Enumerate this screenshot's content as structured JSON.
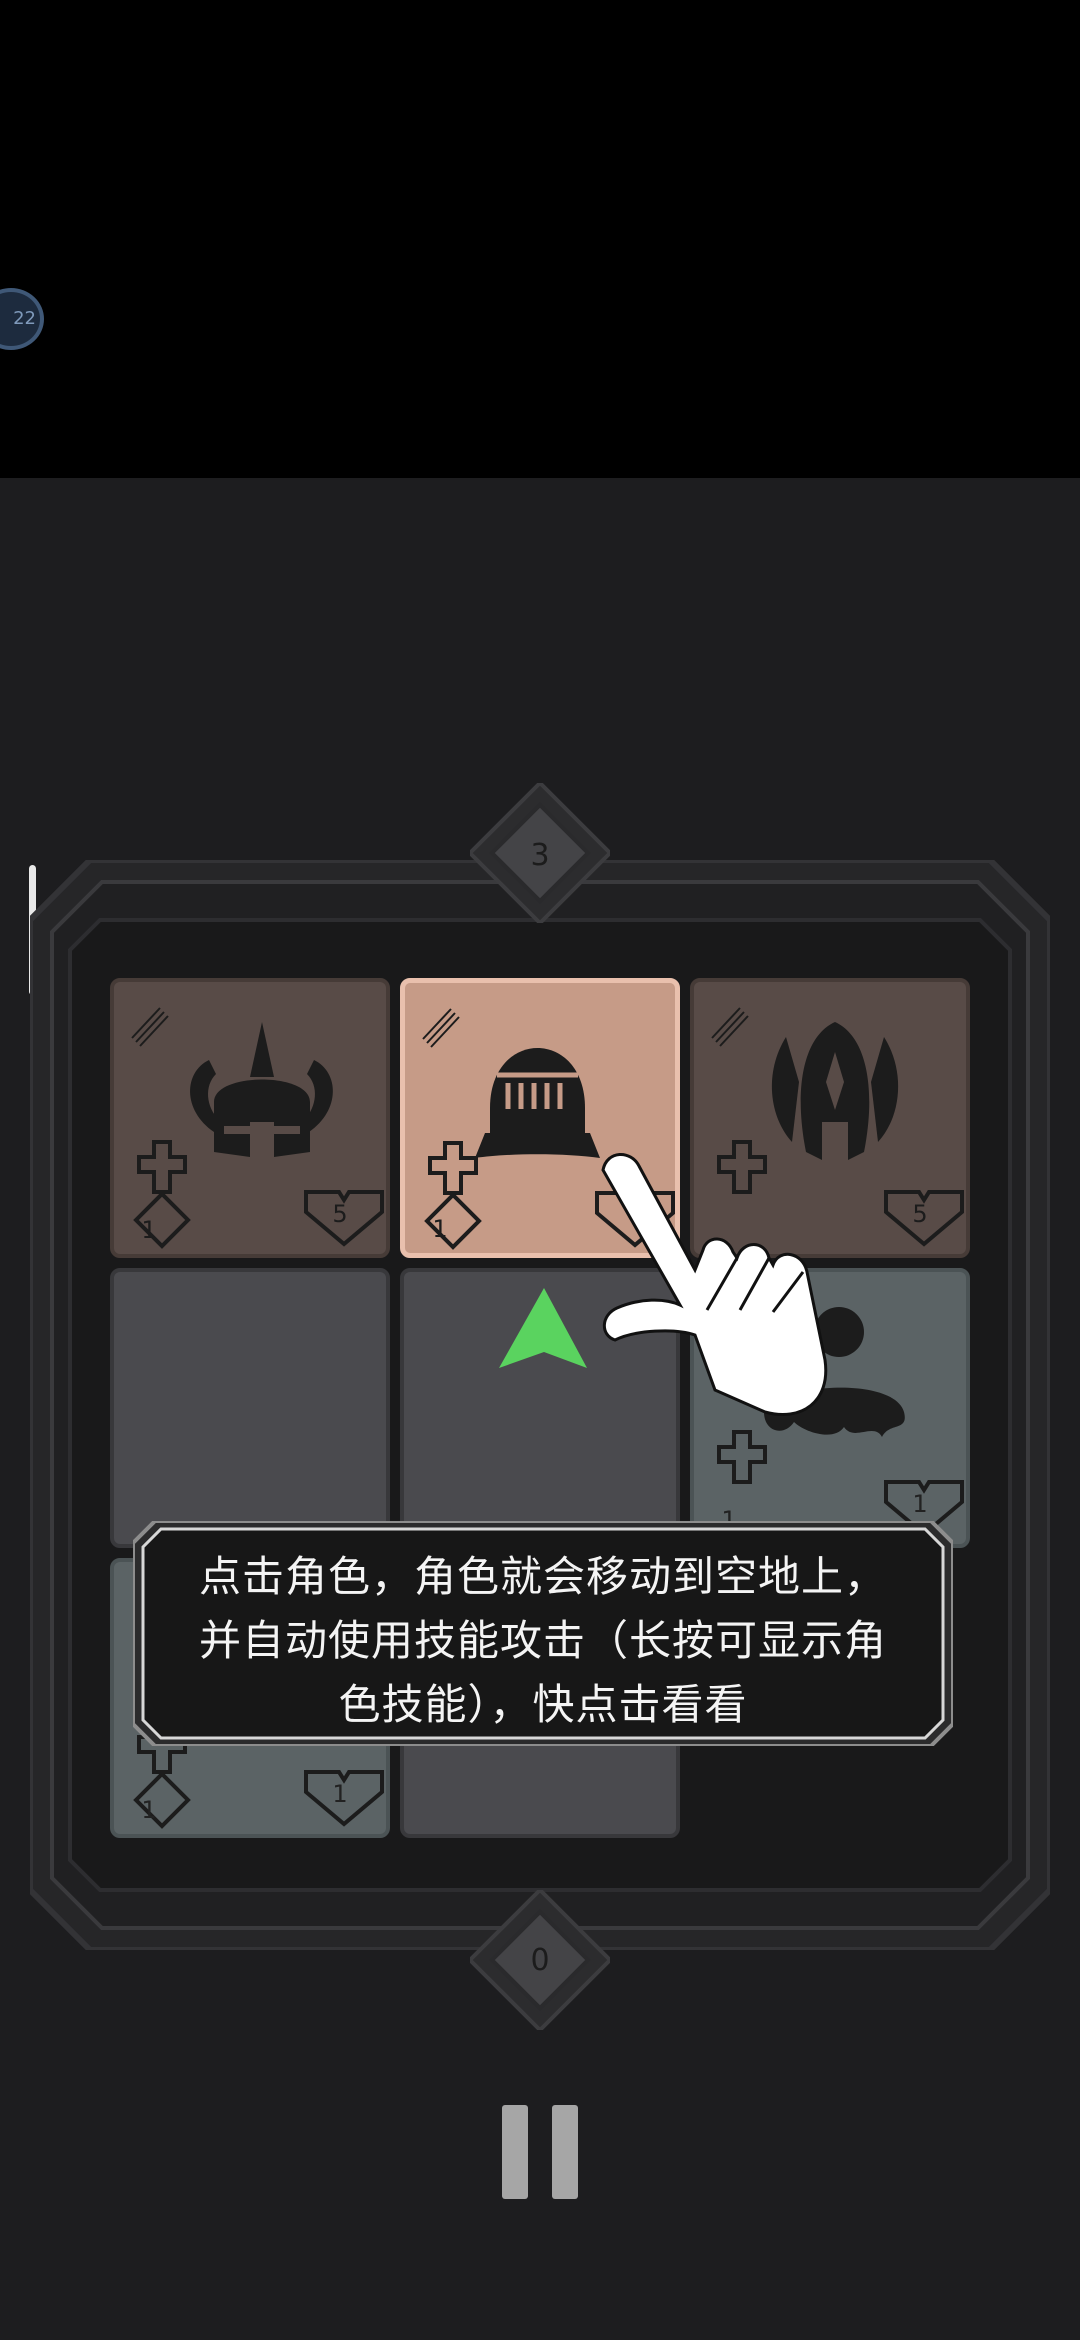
{
  "status_badge": {
    "text": "22"
  },
  "board": {
    "top_counter": "3",
    "bottom_counter": "0",
    "tiles": [
      {
        "kind": "hero",
        "icon": "horned-helmet-icon",
        "attack": "1",
        "health": "5"
      },
      {
        "kind": "hero-selected",
        "icon": "knight-helmet-icon",
        "attack": "1",
        "health": ""
      },
      {
        "kind": "hero",
        "icon": "winged-helmet-icon",
        "attack": "",
        "health": "5"
      },
      {
        "kind": "empty"
      },
      {
        "kind": "empty",
        "marker": "green-up-arrow-icon"
      },
      {
        "kind": "enemy",
        "icon": "skull-slime-icon",
        "attack": "1",
        "health": "1"
      },
      {
        "kind": "enemy",
        "icon": "",
        "attack": "1",
        "health": "1"
      },
      {
        "kind": "empty"
      }
    ]
  },
  "tutorial": {
    "text": "点击角色，角色就会移动到空地上，并自动使用技能攻击（长按可显示角色技能），快点击看看",
    "pointer_icon": "tap-hand-icon"
  },
  "controls": {
    "pause_icon": "pause-icon"
  },
  "colors": {
    "hero_tile": "#584b47",
    "selected_tile": "#c69b87",
    "enemy_tile": "#5b6365",
    "empty_tile": "#4a4a4e",
    "arrow": "#5ad35f"
  }
}
